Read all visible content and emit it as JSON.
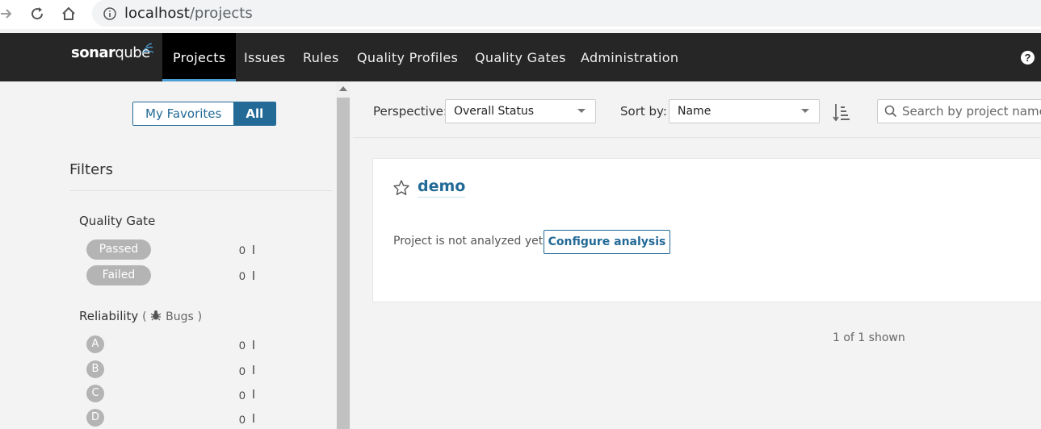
{
  "browser": {
    "url_host": "localhost",
    "url_path": "/projects"
  },
  "nav": {
    "logo_bold": "sonar",
    "logo_light": "qube",
    "items": [
      {
        "label": "Projects",
        "active": true
      },
      {
        "label": "Issues"
      },
      {
        "label": "Rules"
      },
      {
        "label": "Quality Profiles"
      },
      {
        "label": "Quality Gates"
      },
      {
        "label": "Administration"
      }
    ],
    "help": "?"
  },
  "sidebar": {
    "toggle": {
      "favorites": "My Favorites",
      "all": "All"
    },
    "filters_title": "Filters",
    "quality_gate": {
      "title": "Quality Gate",
      "options": [
        {
          "label": "Passed",
          "count": "0"
        },
        {
          "label": "Failed",
          "count": "0"
        }
      ]
    },
    "reliability": {
      "title": "Reliability",
      "open_paren": "(",
      "sub": "Bugs",
      "close_paren": ")",
      "options": [
        {
          "label": "A",
          "count": "0"
        },
        {
          "label": "B",
          "count": "0"
        },
        {
          "label": "C",
          "count": "0"
        },
        {
          "label": "D",
          "count": "0"
        }
      ]
    }
  },
  "toolbar": {
    "perspective_label": "Perspective:",
    "perspective_value": "Overall Status",
    "sort_label": "Sort by:",
    "sort_value": "Name",
    "search_placeholder": "Search by project name or key"
  },
  "project": {
    "name": "demo",
    "status_text": "Project is not analyzed yet.",
    "configure_label": "Configure analysis"
  },
  "footer": {
    "shown": "1 of 1 shown"
  }
}
